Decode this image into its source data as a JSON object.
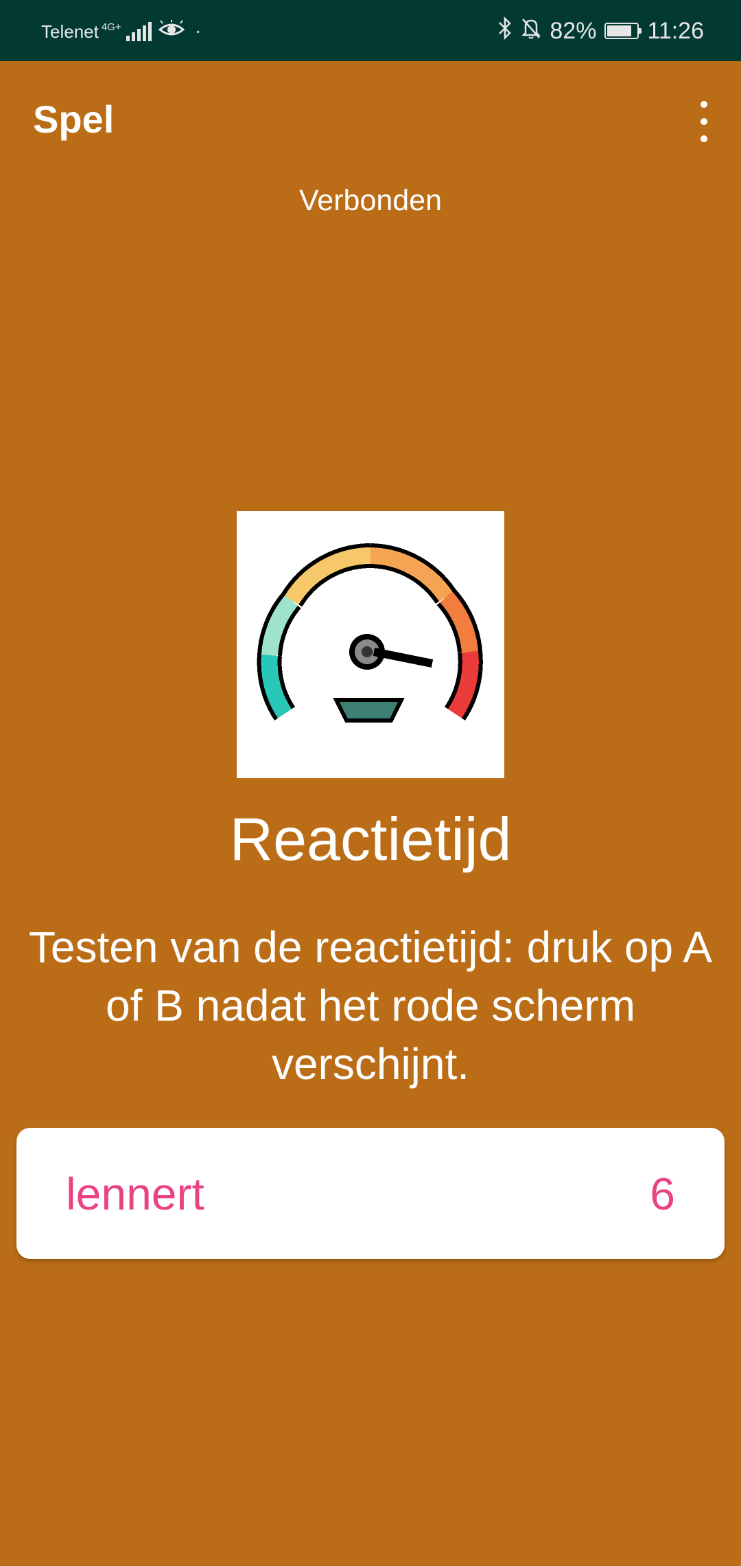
{
  "status_bar": {
    "carrier": "Telenet",
    "network": "4G+",
    "battery": "82%",
    "battery_level": 0.82,
    "time": "11:26",
    "icons": [
      "signal-icon",
      "eye-icon",
      "bluetooth-icon",
      "bell-off-icon",
      "battery-icon"
    ]
  },
  "app_bar": {
    "title": "Spel",
    "menu_icon": "more-vert-icon"
  },
  "connection_status": "Verbonden",
  "game": {
    "icon": "speedometer-icon",
    "title": "Reactietijd",
    "description": "Testen van de reactietijd: druk op A of B nadat het rode scherm verschijnt."
  },
  "players": [
    {
      "name": "lennert",
      "score": "6"
    }
  ],
  "colors": {
    "background": "#BA6D16",
    "status_bar": "#023A33",
    "player_text": "#E94383"
  }
}
